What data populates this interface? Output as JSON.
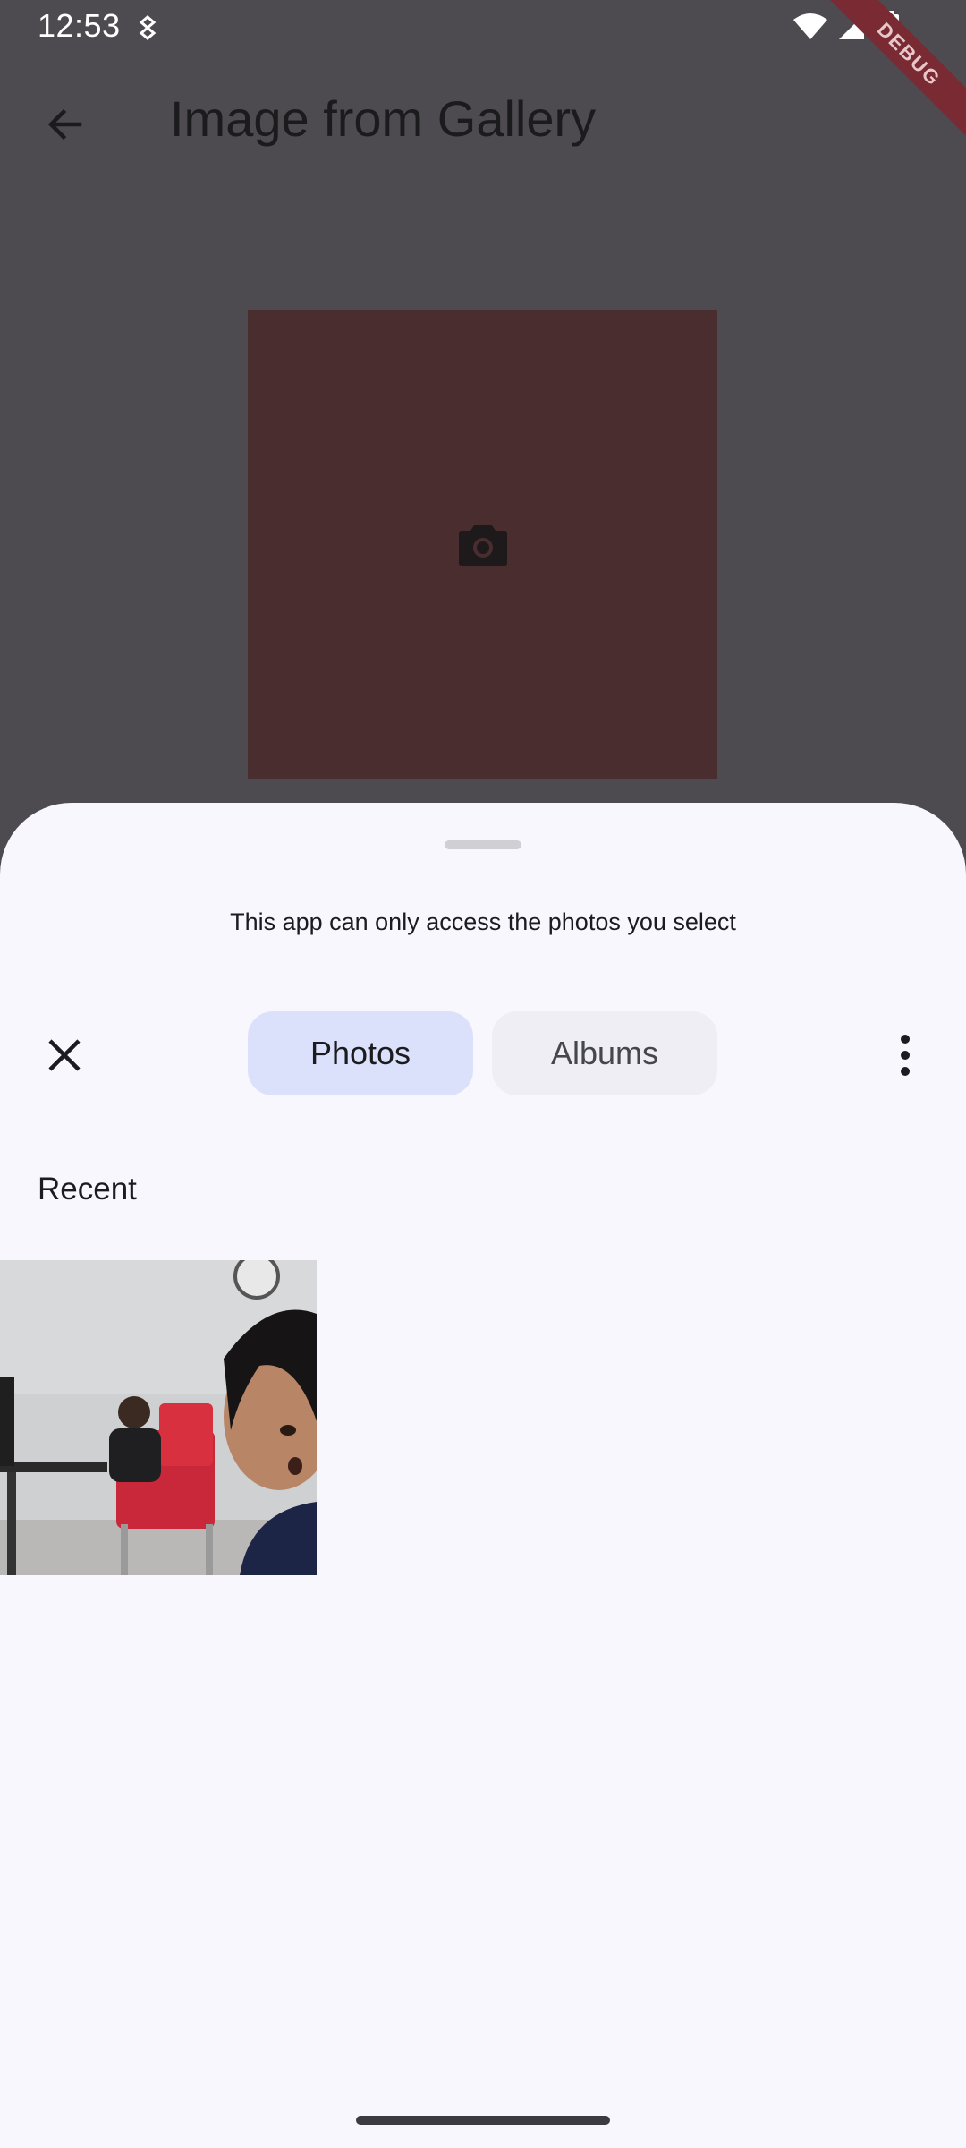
{
  "status_bar": {
    "time": "12:53",
    "icons": [
      "sync-icon",
      "wifi-icon",
      "signal-icon",
      "battery-icon"
    ]
  },
  "debug_banner": {
    "label": "DEBUG"
  },
  "app_bar": {
    "title": "Image from Gallery",
    "back_icon": "arrow-back-icon"
  },
  "placeholder": {
    "icon": "camera-icon",
    "color": "#4a2d2f"
  },
  "picker": {
    "message": "This app can only access the photos you select",
    "tabs": [
      {
        "label": "Photos",
        "selected": true
      },
      {
        "label": "Albums",
        "selected": false
      }
    ],
    "close_icon": "close-icon",
    "more_icon": "more-vert-icon",
    "section_heading": "Recent",
    "photos": [
      {
        "description_icon": "photo-thumbnail"
      }
    ]
  },
  "colors": {
    "scrim": "#4e4b50",
    "sheet": "#f8f7fd",
    "tab_selected": "#dce1fb",
    "tab_unselected": "#efeef4",
    "debug": "#7a2a33"
  }
}
